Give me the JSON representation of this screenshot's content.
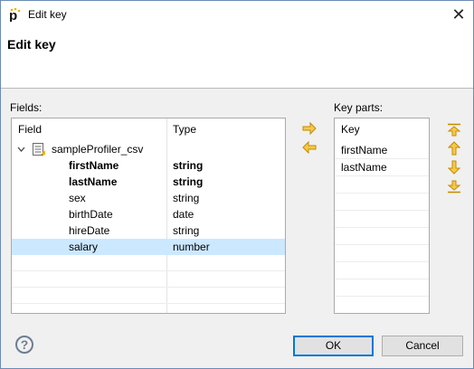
{
  "window": {
    "title": "Edit key",
    "close_symbol": "✕"
  },
  "header": {
    "title": "Edit key"
  },
  "fields_panel": {
    "label": "Fields:",
    "columns": [
      "Field",
      "Type"
    ],
    "parent": {
      "name": "sampleProfiler_csv",
      "icon": "table-icon",
      "expanded": true
    },
    "rows": [
      {
        "field": "firstName",
        "type": "string",
        "bold": true,
        "selected": false
      },
      {
        "field": "lastName",
        "type": "string",
        "bold": true,
        "selected": false
      },
      {
        "field": "sex",
        "type": "string",
        "bold": false,
        "selected": false
      },
      {
        "field": "birthDate",
        "type": "date",
        "bold": false,
        "selected": false
      },
      {
        "field": "hireDate",
        "type": "string",
        "bold": false,
        "selected": false
      },
      {
        "field": "salary",
        "type": "number",
        "bold": false,
        "selected": true
      }
    ]
  },
  "key_parts_panel": {
    "label": "Key parts:",
    "column": "Key",
    "rows": [
      "firstName",
      "lastName"
    ]
  },
  "transfer_buttons": [
    "arrow-right-icon",
    "arrow-left-icon"
  ],
  "order_buttons": [
    "move-top-icon",
    "move-up-icon",
    "move-down-icon",
    "move-bottom-icon"
  ],
  "footer": {
    "help_symbol": "?",
    "ok_label": "OK",
    "cancel_label": "Cancel"
  },
  "colors": {
    "selection": "#cce8ff",
    "arrow": "#f0b400",
    "accent": "#0078d7"
  }
}
